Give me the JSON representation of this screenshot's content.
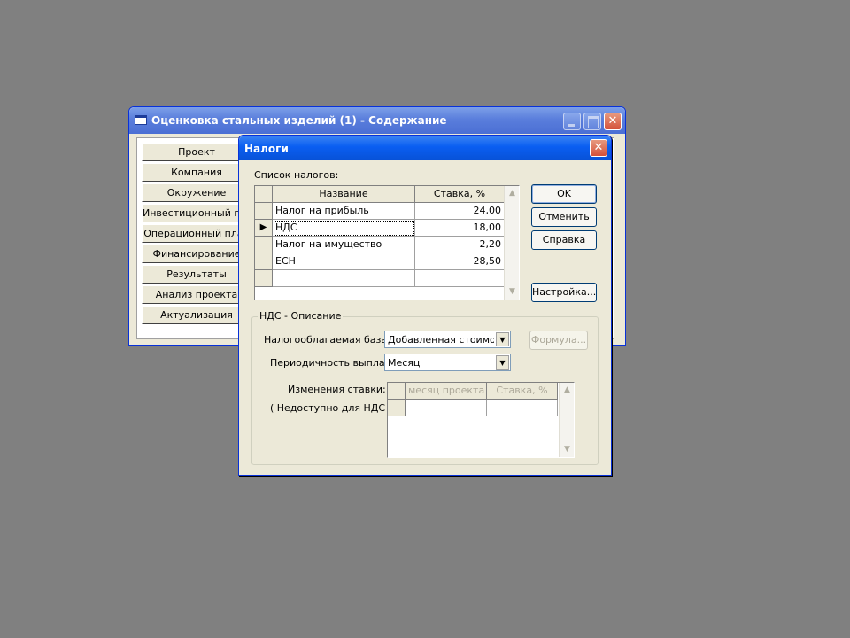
{
  "back_window": {
    "title": "Оценковка стальных изделий (1) - Содержание",
    "nav_items": [
      "Проект",
      "Компания",
      "Окружение",
      "Инвестиционный план",
      "Операционный план",
      "Финансирование",
      "Результаты",
      "Анализ проекта",
      "Актуализация"
    ]
  },
  "dialog": {
    "title": "Налоги",
    "list_label": "Список налогов:",
    "columns": [
      "Название",
      "Ставка, %"
    ],
    "rows": [
      {
        "name": "Налог на прибыль",
        "rate": "24,00"
      },
      {
        "name": "НДС",
        "rate": "18,00"
      },
      {
        "name": "Налог на имущество",
        "rate": "2,20"
      },
      {
        "name": "ЕСН",
        "rate": "28,50"
      }
    ],
    "current_row_marker": "▶",
    "buttons": {
      "ok": "OK",
      "cancel": "Отменить",
      "help": "Справка",
      "settings": "Настройка..."
    },
    "desc_group": {
      "title": "НДС - Описание",
      "tax_base_label": "Налогооблагаемая база:",
      "tax_base_value": "Добавленная стоимость",
      "formula_button": "Формула...",
      "periodicity_label": "Периодичность выплат:",
      "periodicity_value": "Месяц",
      "rate_changes_label": "Изменения ставки:",
      "unavailable_note": "( Недоступно для НДС )",
      "rate_columns": [
        "месяц проекта",
        "Ставка, %"
      ]
    }
  },
  "icons": {
    "scroll_up": "▲",
    "scroll_down": "▼",
    "dropdown": "▼",
    "close": "✕"
  }
}
